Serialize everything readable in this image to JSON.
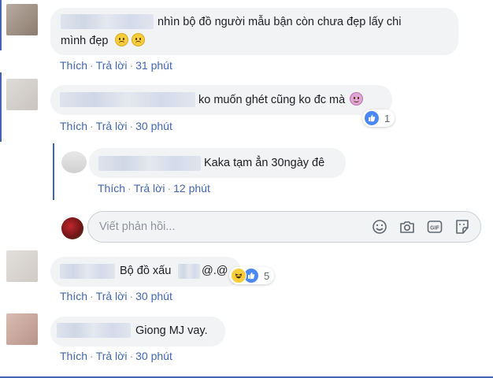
{
  "comments": [
    {
      "text_line1": "nhìn bộ đồ người mẫu bận còn chưa đẹp lấy chi",
      "text_line2": "mình đẹp",
      "actions": {
        "like": "Thích",
        "reply": "Trả lời",
        "time": "31 phút"
      }
    },
    {
      "text": "ko muốn ghét cũng ko đc mà",
      "reaction_count": "1",
      "actions": {
        "like": "Thích",
        "reply": "Trả lời",
        "time": "30 phút"
      }
    },
    {
      "text": "Kaka tạm ẳn 30ngày đê",
      "actions": {
        "like": "Thích",
        "reply": "Trả lời",
        "time": "12 phút"
      }
    },
    {
      "text": "Bộ đồ xấu",
      "text_suffix": "@.@",
      "reaction_count": "5",
      "actions": {
        "like": "Thích",
        "reply": "Trả lời",
        "time": "30 phút"
      }
    },
    {
      "text": "Giong MJ vay.",
      "actions": {
        "like": "Thích",
        "reply": "Trả lời",
        "time": "30 phút"
      }
    }
  ],
  "reply_box": {
    "placeholder": "Viết phản hồi..."
  },
  "icons": [
    "smile-icon",
    "camera-icon",
    "gif-icon",
    "sticker-icon",
    "like-reaction-icon",
    "haha-reaction-icon",
    "sad-emoji-icon",
    "dizzy-emoji-icon"
  ],
  "colors": {
    "link": "#4267b2",
    "bubble": "#f2f3f5",
    "meta": "#616770",
    "thread_line": "#4267b2"
  }
}
